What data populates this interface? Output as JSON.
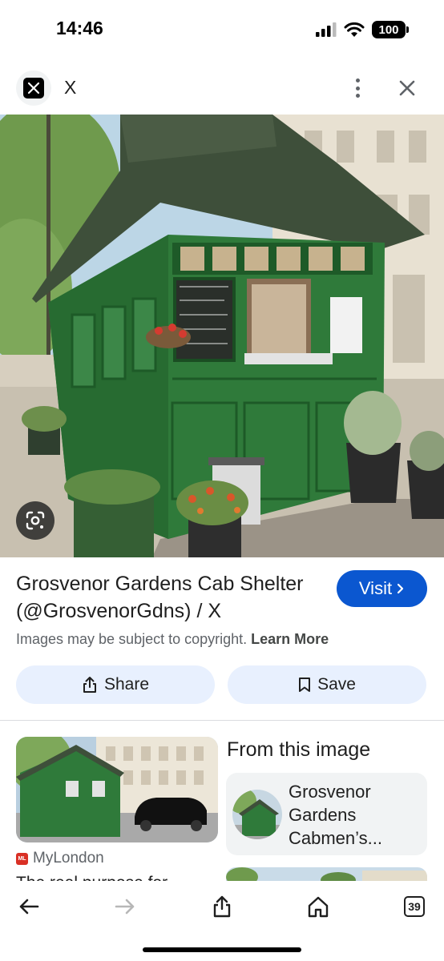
{
  "status_bar": {
    "time": "14:46",
    "battery": "100"
  },
  "header": {
    "title": "X",
    "logo_icon": "x-logo-icon"
  },
  "result": {
    "title": "Grosvenor Gardens Cab Shelter (@GrosvenorGdns) / X",
    "visit_label": "Visit",
    "copyright_text": "Images may be subject to copyright.",
    "learn_more_label": "Learn More",
    "share_label": "Share",
    "save_label": "Save"
  },
  "related": {
    "source_name": "MyLondon",
    "source_badge": "ML",
    "snippet": "The real purpose for"
  },
  "from_this_image": {
    "title": "From this image",
    "item_label": "Grosvenor Gardens Cabmen’s..."
  },
  "toolbar": {
    "tabs_count": "39"
  },
  "colors": {
    "accent": "#0b57d0",
    "button_bg": "#e8f0fe",
    "shelter_green": "#2f7a3a"
  }
}
